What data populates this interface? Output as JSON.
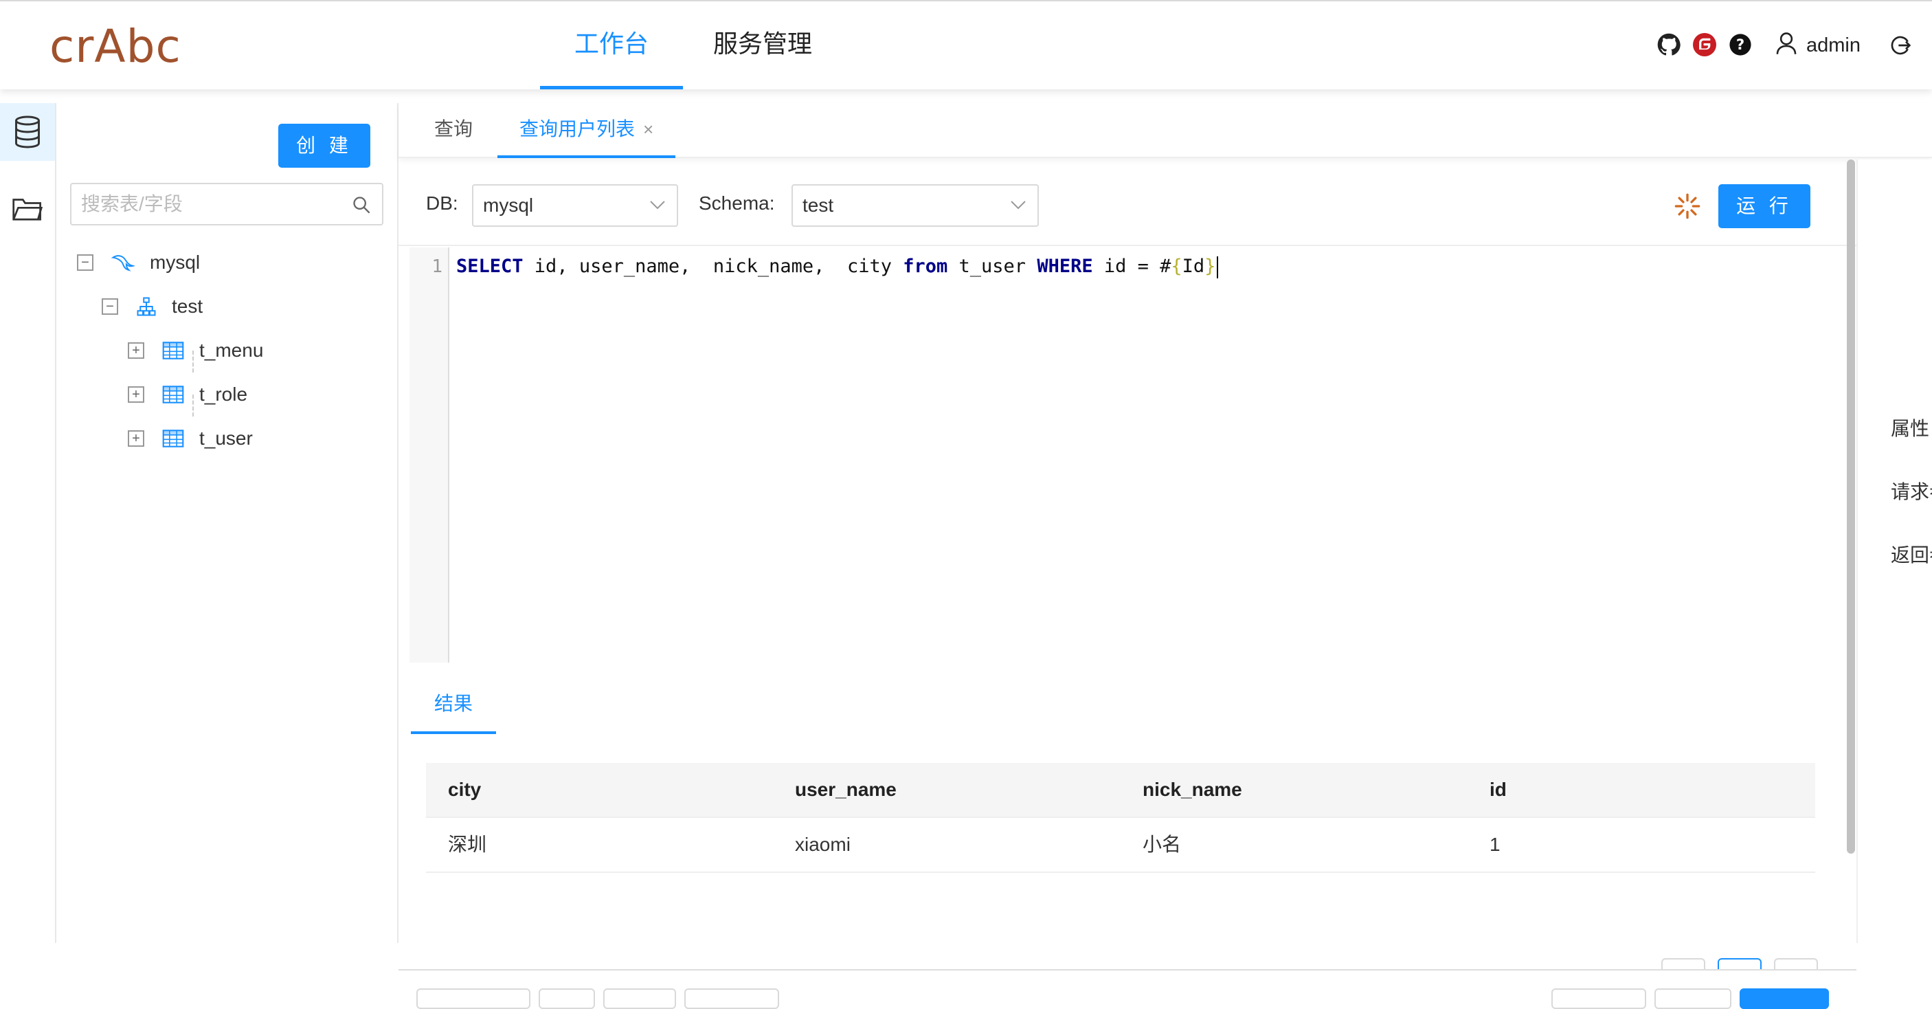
{
  "header": {
    "logo": "crAbc",
    "nav": [
      "工作台",
      "服务管理"
    ],
    "active_nav": 0,
    "user": "admin",
    "icons": [
      "github-icon",
      "gitee-icon",
      "help-icon",
      "user-icon",
      "logout-icon"
    ]
  },
  "rail": {
    "items": [
      "database-icon",
      "folder-icon"
    ]
  },
  "tree": {
    "create_label": "创 建",
    "search_placeholder": "搜索表/字段",
    "db": "mysql",
    "schema": "test",
    "tables": [
      "t_menu",
      "t_role",
      "t_user"
    ]
  },
  "tabs": [
    {
      "label": "查询"
    },
    {
      "label": "查询用户列表",
      "closable": true
    }
  ],
  "toolbar": {
    "db_label": "DB:",
    "db_value": "mysql",
    "schema_label": "Schema:",
    "schema_value": "test",
    "run_label": "运 行"
  },
  "editor": {
    "line_no": "1",
    "tokens": {
      "select": "SELECT",
      "cols": " id, user_name,  nick_name,  city ",
      "from": "from",
      "table": " t_user ",
      "where": "WHERE",
      "cond": " id = #",
      "open_brace": "{",
      "param": "Id",
      "close_brace": "}"
    }
  },
  "results": {
    "tab_label": "结果",
    "columns": [
      "city",
      "user_name",
      "nick_name",
      "id"
    ],
    "rows": [
      [
        "深圳",
        "xiaomi",
        "小名",
        "1"
      ]
    ]
  },
  "right_panel": {
    "items": [
      "属性",
      "请求参数",
      "返回参数"
    ]
  },
  "colors": {
    "primary": "#1890ff",
    "logo": "#a0522d",
    "loading": "#d2691e"
  }
}
